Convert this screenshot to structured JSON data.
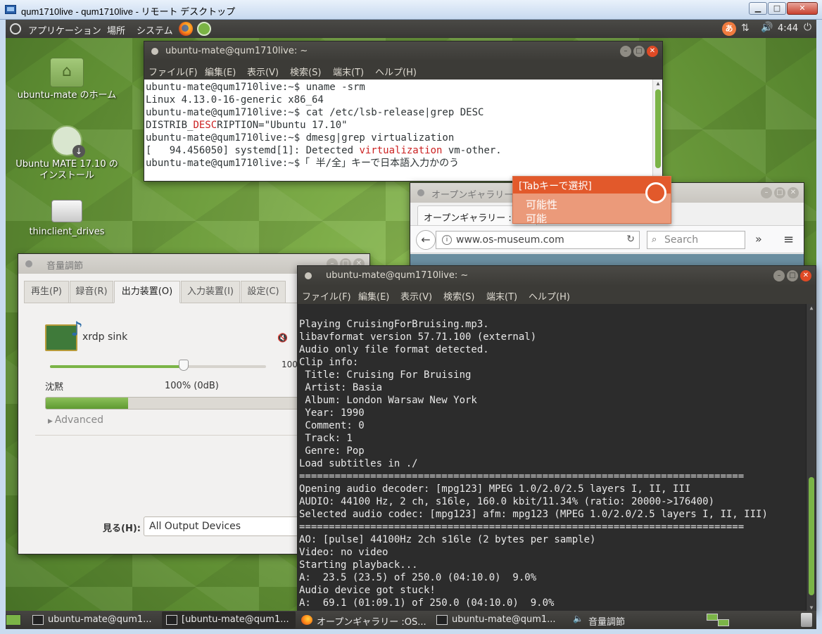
{
  "rdp": {
    "title": "qum1710live - qum1710live - リモート デスクトップ",
    "min_label": "▁",
    "max_label": "□",
    "close_label": "✕"
  },
  "top_panel": {
    "menus": [
      "アプリケーション",
      "場所",
      "システム"
    ],
    "ime_label": "あ",
    "clock": "4:44",
    "icons": [
      "ubuntu-logo",
      "firefox",
      "ubuntu-mate",
      "ime",
      "network",
      "volume",
      "power"
    ]
  },
  "desktop_icons": [
    {
      "label": "ubuntu-mate のホーム",
      "icon": "home-folder"
    },
    {
      "label": "Ubuntu MATE 17.10 のインストール",
      "icon": "install"
    },
    {
      "label": "thinclient_drives",
      "icon": "drive"
    }
  ],
  "term1": {
    "title": "ubuntu-mate@qum1710live: ~",
    "menu": [
      "ファイル(F)",
      "編集(E)",
      "表示(V)",
      "検索(S)",
      "端末(T)",
      "ヘルプ(H)"
    ],
    "lines": [
      {
        "t": "ubuntu-mate@qum1710live:~$ uname -srm"
      },
      {
        "t": "Linux 4.13.0-16-generic x86_64"
      },
      {
        "t": "ubuntu-mate@qum1710live:~$ cat /etc/lsb-release|grep DESC"
      },
      {
        "pre": "DISTRIB_",
        "red": "DESC",
        "post": "RIPTION=\"Ubuntu 17.10\""
      },
      {
        "t": "ubuntu-mate@qum1710live:~$ dmesg|grep virtualization"
      },
      {
        "pre": "[   94.456050] systemd[1]: Detected ",
        "red": "virtualization",
        "post": " vm-other."
      },
      {
        "t": "ubuntu-mate@qum1710live:~$「 半/全」キーで日本語入力かのう"
      }
    ]
  },
  "ime": {
    "header": "[Tabキーで選択]",
    "candidates": [
      "可能性",
      "可能"
    ]
  },
  "firefox": {
    "title": "オープンギャラリー :",
    "tab": "オープンギャラリー :",
    "url": "www.os-museum.com",
    "search_placeholder": "Search",
    "more": "»",
    "menu": "≡",
    "back": "←",
    "reload": "↻",
    "info": "i",
    "search_icon": "⌕"
  },
  "volume": {
    "title": "音量調節",
    "tabs": [
      "再生(P)",
      "録音(R)",
      "出力装置(O)",
      "入力装置(I)",
      "設定(C)"
    ],
    "active_tab": 2,
    "device_name": "xrdp sink",
    "mute_icon": "🔇",
    "volume_level": 0.62,
    "max_label": "100",
    "silence_label": "沈黙",
    "percent_label": "100% (0dB)",
    "peak_level": 0.31,
    "advanced_label": "Advanced",
    "view_label": "見る(H):",
    "view_value": "All Output Devices"
  },
  "term2": {
    "title": "ubuntu-mate@qum1710live: ~",
    "menu": [
      "ファイル(F)",
      "編集(E)",
      "表示(V)",
      "検索(S)",
      "端末(T)",
      "ヘルプ(H)"
    ],
    "lines": [
      "",
      "Playing CruisingForBruising.mp3.",
      "libavformat version 57.71.100 (external)",
      "Audio only file format detected.",
      "Clip info:",
      " Title: Cruising For Bruising",
      " Artist: Basia",
      " Album: London Warsaw New York",
      " Year: 1990",
      " Comment: 0",
      " Track: 1",
      " Genre: Pop",
      "Load subtitles in ./",
      "===========================================================================",
      "Opening audio decoder: [mpg123] MPEG 1.0/2.0/2.5 layers I, II, III",
      "AUDIO: 44100 Hz, 2 ch, s16le, 160.0 kbit/11.34% (ratio: 20000->176400)",
      "Selected audio codec: [mpg123] afm: mpg123 (MPEG 1.0/2.0/2.5 layers I, II, III)",
      "===========================================================================",
      "AO: [pulse] 44100Hz 2ch s16le (2 bytes per sample)",
      "Video: no video",
      "Starting playback...",
      "A:  23.5 (23.5) of 250.0 (04:10.0)  9.0%",
      "Audio device got stuck!",
      "A:  69.1 (01:09.1) of 250.0 (04:10.0)  9.0%"
    ]
  },
  "taskbar": {
    "items": [
      {
        "label": "ubuntu-mate@qum1...",
        "icon": "terminal"
      },
      {
        "label": "[ubuntu-mate@qum1...",
        "icon": "terminal"
      },
      {
        "label": "オープンギャラリー :OS...",
        "icon": "firefox"
      },
      {
        "label": "ubuntu-mate@qum1...",
        "icon": "terminal"
      },
      {
        "label": "音量調節",
        "icon": "speaker"
      }
    ]
  },
  "colors": {
    "accent_green": "#7bb447",
    "terminal_red": "#cc2222",
    "ime_orange": "#e2592b",
    "close_orange": "#df4a25"
  }
}
